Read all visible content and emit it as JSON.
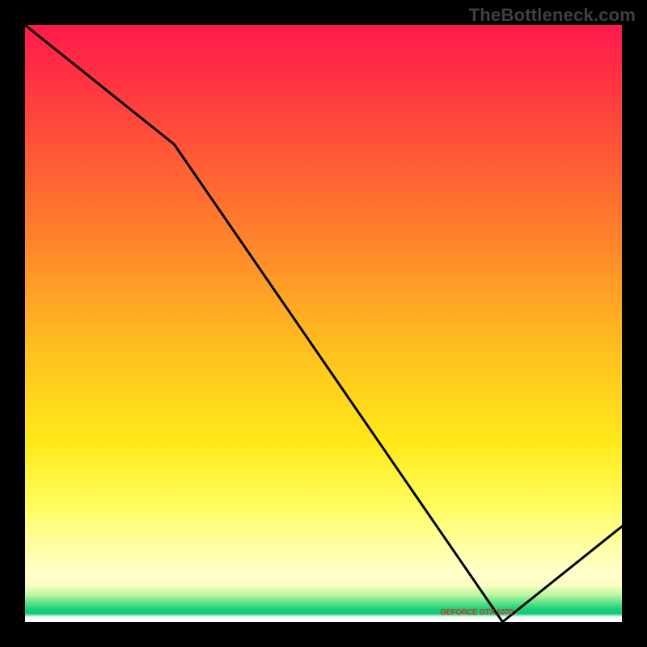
{
  "attribution": "TheBottleneck.com",
  "label_text": "GEFORCE GTX 1070",
  "colors": {
    "background": "#000000",
    "curve": "#000000",
    "label": "#c23b2e"
  },
  "chart_data": {
    "type": "line",
    "title": "",
    "xlabel": "",
    "ylabel": "",
    "xlim": [
      0,
      100
    ],
    "ylim": [
      0,
      100
    ],
    "grid": false,
    "series": [
      {
        "name": "bottleneck-curve",
        "x": [
          0,
          25,
          80,
          100
        ],
        "values": [
          100,
          80,
          0,
          16
        ]
      }
    ],
    "annotations": [
      {
        "text": "GEFORCE GTX 1070",
        "x": 77,
        "y": 1.5
      }
    ],
    "gradient_stops": [
      {
        "pct": 0,
        "color": "#ff1a4b"
      },
      {
        "pct": 22,
        "color": "#ff5a36"
      },
      {
        "pct": 55,
        "color": "#ffc21f"
      },
      {
        "pct": 80,
        "color": "#fffc5a"
      },
      {
        "pct": 96,
        "color": "#5fe08a"
      },
      {
        "pct": 99,
        "color": "#ffffff"
      }
    ]
  }
}
